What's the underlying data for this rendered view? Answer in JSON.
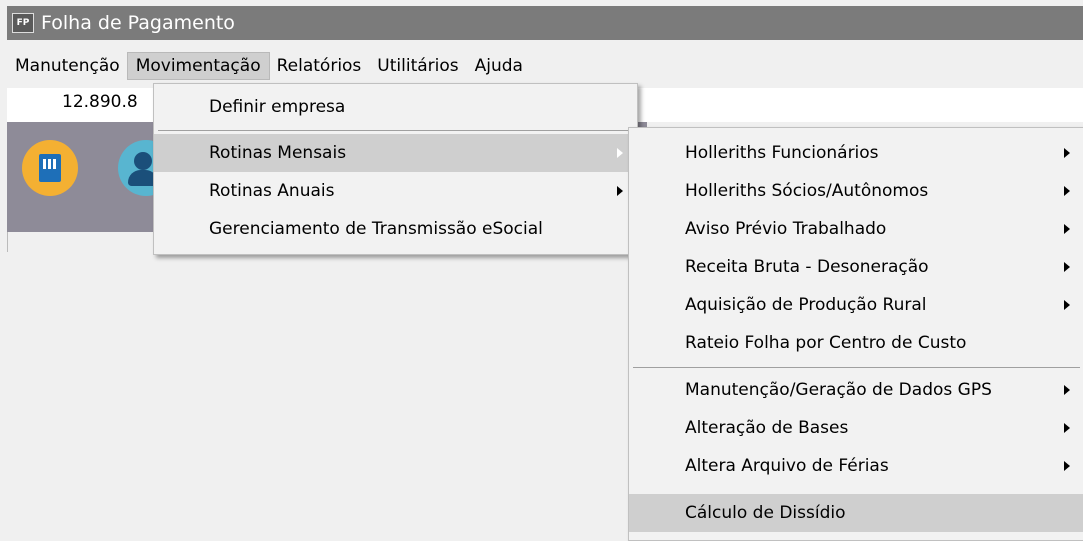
{
  "window": {
    "app_icon": "FP",
    "title": "Folha de Pagamento"
  },
  "menubar": [
    {
      "label": "Manutenção"
    },
    {
      "label": "Movimentação"
    },
    {
      "label": "Relatórios"
    },
    {
      "label": "Utilitários"
    },
    {
      "label": "Ajuda"
    }
  ],
  "toolbar": {
    "value": "12.890.8"
  },
  "icons": [
    "building-icon",
    "person-icon"
  ],
  "menu_movimentacao": [
    {
      "label": "Definir empresa",
      "submenu": false
    },
    {
      "label": "Rotinas Mensais",
      "submenu": true,
      "highlighted": true
    },
    {
      "label": "Rotinas Anuais",
      "submenu": true
    },
    {
      "label": "Gerenciamento de Transmissão eSocial",
      "submenu": false
    }
  ],
  "menu_rotinas_mensais": [
    {
      "label": "Holleriths Funcionários",
      "submenu": true
    },
    {
      "label": "Holleriths Sócios/Autônomos",
      "submenu": true
    },
    {
      "label": "Aviso Prévio Trabalhado",
      "submenu": true
    },
    {
      "label": "Receita Bruta - Desoneração",
      "submenu": true
    },
    {
      "label": "Aquisição de Produção Rural",
      "submenu": true
    },
    {
      "label": "Rateio Folha por Centro de Custo",
      "submenu": false
    },
    {
      "label": "Manutenção/Geração de Dados GPS",
      "submenu": true
    },
    {
      "label": "Alteração de Bases",
      "submenu": true
    },
    {
      "label": "Altera Arquivo de Férias",
      "submenu": true
    },
    {
      "label": "Cálculo de Dissídio",
      "submenu": false,
      "highlighted": true
    }
  ],
  "colors": {
    "titlebar": "#7b7b7b",
    "highlight": "#cfcfcf",
    "panel": "#8e8b98"
  }
}
